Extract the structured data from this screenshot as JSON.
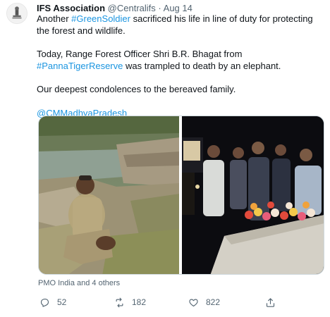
{
  "author": {
    "name": "IFS Association",
    "handle": "@Centralifs",
    "separator": "·",
    "date": "Aug 14"
  },
  "tweet": {
    "line1_prefix": "Another ",
    "hashtag1": "#GreenSoldier",
    "line1_suffix": " sacrificed his life in line of duty for protecting the forest and wildlife.",
    "line2_prefix": "Today, Range Forest Officer Shri B.R. Bhagat from ",
    "hashtag2": "#PannaTigerReserve",
    "line2_suffix": " was trampled to death by an elephant.",
    "line3": "Our deepest condolences to the bereaved family.",
    "mention": "@CMMadhyaPradesh"
  },
  "liked_by": "PMO India and 4 others",
  "actions": {
    "replies": "52",
    "retweets": "182",
    "likes": "822"
  },
  "colors": {
    "link": "#1b95e0",
    "secondary_text": "#536471"
  }
}
